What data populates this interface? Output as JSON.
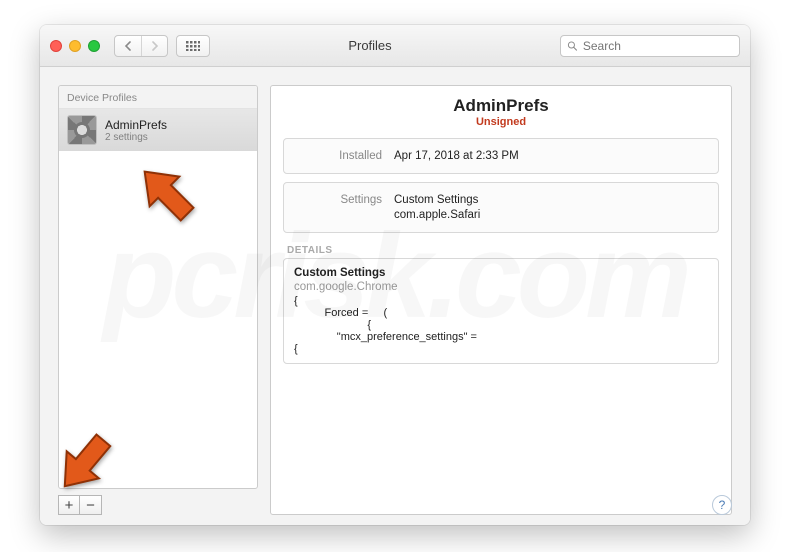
{
  "window": {
    "title": "Profiles",
    "search_placeholder": "Search"
  },
  "sidebar": {
    "section_label": "Device Profiles",
    "items": [
      {
        "name": "AdminPrefs",
        "subtitle": "2 settings",
        "selected": true
      }
    ],
    "add_label": "+",
    "remove_label": "−"
  },
  "detail": {
    "title": "AdminPrefs",
    "status": "Unsigned",
    "installed_label": "Installed",
    "installed_value": "Apr 17, 2018 at 2:33 PM",
    "settings_label": "Settings",
    "settings_value_1": "Custom Settings",
    "settings_value_2": "com.apple.Safari",
    "details_label": "DETAILS",
    "details_heading": "Custom Settings",
    "details_domain": "com.google.Chrome",
    "details_code": "{\n          Forced =     (\n                        {\n              \"mcx_preference_settings\" =\n{"
  },
  "help_label": "?",
  "watermark": "pcrisk.com"
}
